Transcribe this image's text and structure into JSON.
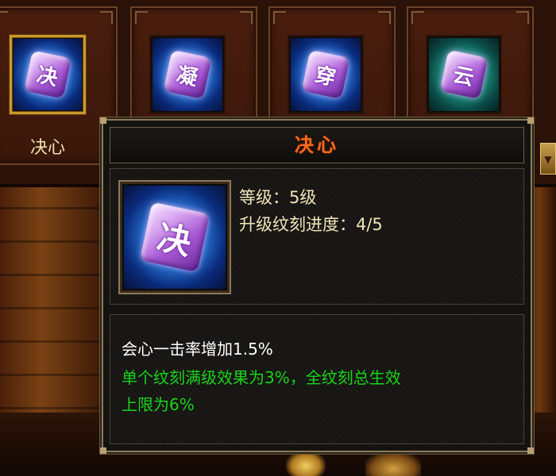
{
  "slots": [
    {
      "glyph": "决",
      "label": "决心",
      "color": "blue",
      "selected": true
    },
    {
      "glyph": "凝",
      "label": "",
      "color": "blue",
      "selected": false
    },
    {
      "glyph": "穿",
      "label": "",
      "color": "blue",
      "selected": false
    },
    {
      "glyph": "云",
      "label": "",
      "color": "teal",
      "selected": false
    }
  ],
  "scroll_button": {
    "icon": "arrow-down-icon",
    "glyph": "▼"
  },
  "tooltip": {
    "title": "决心",
    "icon_glyph": "决",
    "level_text": "等级：5级",
    "progress_text": "升级纹刻进度：4/5",
    "effect_text": "会心一击率增加1.5%",
    "note_line1": "单个纹刻满级效果为3%，全纹刻总生效",
    "note_line2": "上限为6%"
  },
  "colors": {
    "title_orange": "#ff6a1a",
    "note_green": "#19d419",
    "label_cream": "#f2e0b0",
    "selected_gold": "#c99a2a"
  }
}
